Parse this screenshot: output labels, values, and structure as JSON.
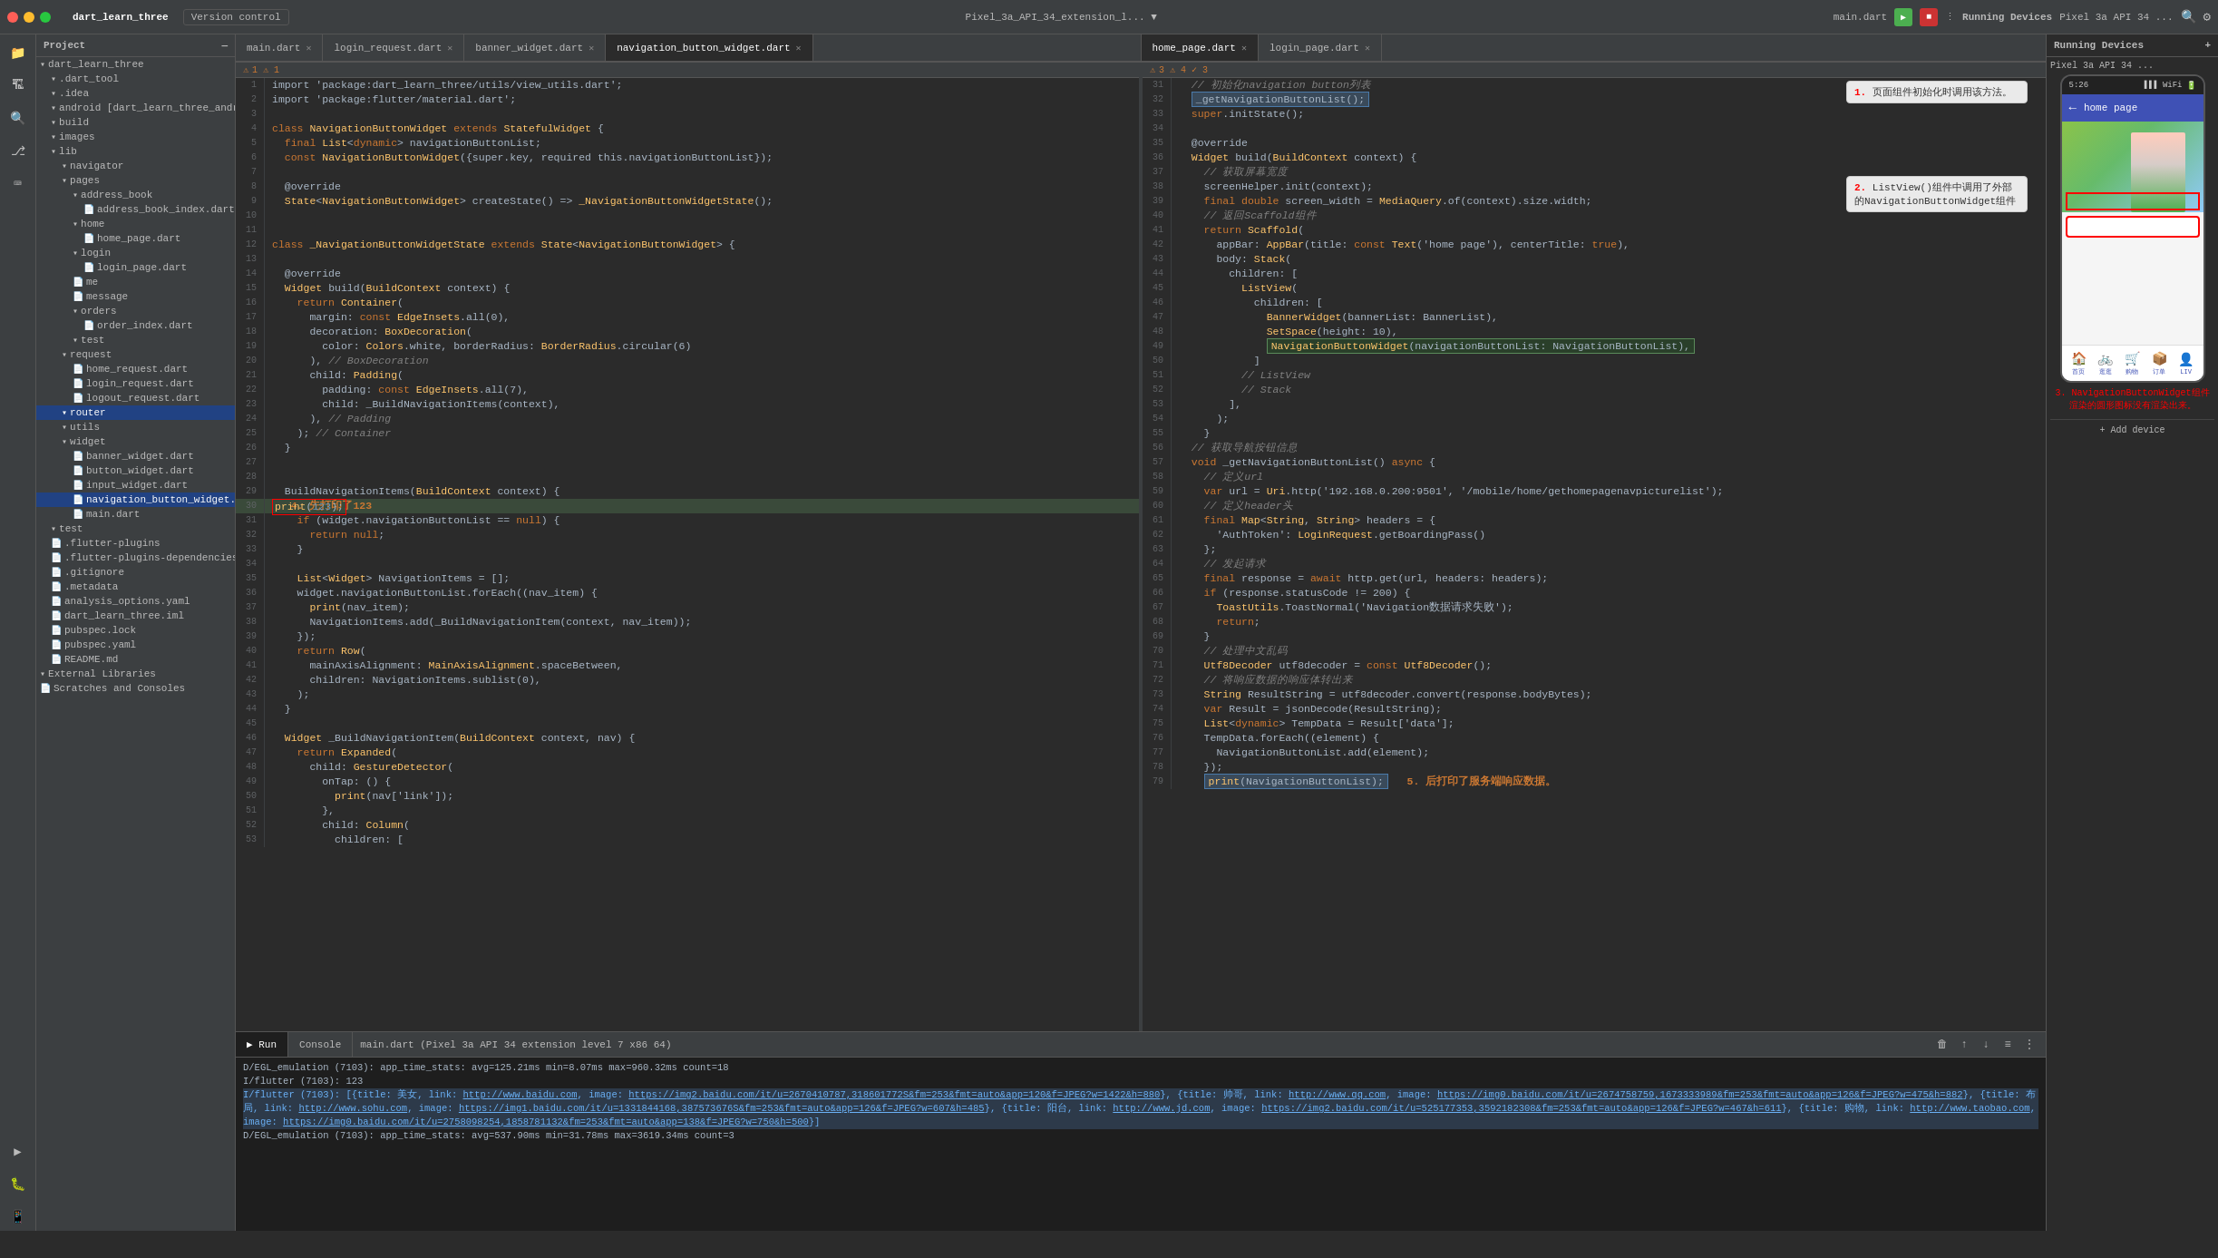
{
  "titleBar": {
    "projectName": "dart_learn_three",
    "versionControl": "Version control",
    "centerTitle": "Pixel_3a_API_34_extension_l... ▼",
    "mainDart": "main.dart",
    "runningDevices": "Running Devices",
    "deviceName": "Pixel 3a API 34 ...",
    "trafficLights": [
      "red",
      "yellow",
      "green"
    ]
  },
  "tabs": {
    "left": [
      {
        "label": "main.dart",
        "active": false
      },
      {
        "label": "login_request.dart",
        "active": false
      },
      {
        "label": "banner_widget.dart",
        "active": false
      },
      {
        "label": "navigation_button_widget.dart",
        "active": true
      }
    ],
    "right": [
      {
        "label": "home_page.dart",
        "active": true
      },
      {
        "label": "login_page.dart",
        "active": false
      }
    ]
  },
  "sidebar": {
    "projectLabel": "Project",
    "items": [
      {
        "indent": 0,
        "icon": "▾",
        "label": "dart_learn_three",
        "path": true
      },
      {
        "indent": 1,
        "icon": "▾",
        "label": ".dart_tool"
      },
      {
        "indent": 1,
        "icon": "▾",
        "label": ".idea"
      },
      {
        "indent": 1,
        "icon": "▾",
        "label": "android [dart_learn_three_android]"
      },
      {
        "indent": 1,
        "icon": "▾",
        "label": "build"
      },
      {
        "indent": 1,
        "icon": "▾",
        "label": "images"
      },
      {
        "indent": 1,
        "icon": "▾",
        "label": "lib"
      },
      {
        "indent": 2,
        "icon": "▾",
        "label": "navigator"
      },
      {
        "indent": 2,
        "icon": "▾",
        "label": "pages"
      },
      {
        "indent": 3,
        "icon": "▾",
        "label": "address_book"
      },
      {
        "indent": 4,
        "icon": "📄",
        "label": "address_book_index.dart"
      },
      {
        "indent": 3,
        "icon": "▾",
        "label": "home"
      },
      {
        "indent": 4,
        "icon": "📄",
        "label": "home_page.dart"
      },
      {
        "indent": 3,
        "icon": "▾",
        "label": "login"
      },
      {
        "indent": 4,
        "icon": "📄",
        "label": "login_page.dart"
      },
      {
        "indent": 3,
        "icon": "📄",
        "label": "me"
      },
      {
        "indent": 3,
        "icon": "📄",
        "label": "message"
      },
      {
        "indent": 3,
        "icon": "▾",
        "label": "orders"
      },
      {
        "indent": 4,
        "icon": "📄",
        "label": "order_index.dart"
      },
      {
        "indent": 3,
        "icon": "▾",
        "label": "test"
      },
      {
        "indent": 2,
        "icon": "▾",
        "label": "request"
      },
      {
        "indent": 3,
        "icon": "📄",
        "label": "home_request.dart"
      },
      {
        "indent": 3,
        "icon": "📄",
        "label": "login_request.dart"
      },
      {
        "indent": 3,
        "icon": "📄",
        "label": "logout_request.dart"
      },
      {
        "indent": 2,
        "icon": "▾",
        "label": "router",
        "selected": true
      },
      {
        "indent": 2,
        "icon": "▾",
        "label": "utils"
      },
      {
        "indent": 2,
        "icon": "▾",
        "label": "widget"
      },
      {
        "indent": 3,
        "icon": "📄",
        "label": "banner_widget.dart"
      },
      {
        "indent": 3,
        "icon": "📄",
        "label": "button_widget.dart"
      },
      {
        "indent": 3,
        "icon": "📄",
        "label": "input_widget.dart"
      },
      {
        "indent": 3,
        "icon": "📄",
        "label": "navigation_button_widget.dart",
        "selected": true
      },
      {
        "indent": 3,
        "icon": "📄",
        "label": "main.dart"
      },
      {
        "indent": 1,
        "icon": "▾",
        "label": "test"
      },
      {
        "indent": 1,
        "icon": "📄",
        "label": ".flutter-plugins"
      },
      {
        "indent": 1,
        "icon": "📄",
        "label": ".flutter-plugins-dependencies"
      },
      {
        "indent": 1,
        "icon": "📄",
        "label": ".gitignore"
      },
      {
        "indent": 1,
        "icon": "📄",
        "label": ".metadata"
      },
      {
        "indent": 1,
        "icon": "📄",
        "label": "analysis_options.yaml"
      },
      {
        "indent": 1,
        "icon": "📄",
        "label": "dart_learn_three.iml"
      },
      {
        "indent": 1,
        "icon": "📄",
        "label": "pubspec.lock"
      },
      {
        "indent": 1,
        "icon": "📄",
        "label": "pubspec.yaml"
      },
      {
        "indent": 1,
        "icon": "📄",
        "label": "README.md"
      },
      {
        "indent": 0,
        "icon": "▾",
        "label": "External Libraries"
      },
      {
        "indent": 0,
        "icon": "📄",
        "label": "Scratches and Consoles"
      }
    ]
  },
  "leftEditor": {
    "filename": "navigation_button_widget.dart",
    "lines": [
      {
        "num": 1,
        "content": "import 'package:dart_learn_three/utils/view_utils.dart';"
      },
      {
        "num": 2,
        "content": "import 'package:flutter/material.dart';"
      },
      {
        "num": 3,
        "content": ""
      },
      {
        "num": 4,
        "content": "class NavigationButtonWidget extends StatefulWidget {"
      },
      {
        "num": 5,
        "content": "  final List<dynamic> navigationButtonList;"
      },
      {
        "num": 6,
        "content": "  const NavigationButtonWidget({super.key, required this.navigationButtonList});"
      },
      {
        "num": 7,
        "content": ""
      },
      {
        "num": 8,
        "content": "  @override"
      },
      {
        "num": 9,
        "content": "  State<NavigationButtonWidget> createState() => _NavigationButtonWidgetState();"
      },
      {
        "num": 10,
        "content": ""
      },
      {
        "num": 11,
        "content": ""
      },
      {
        "num": 12,
        "content": "class _NavigationButtonWidgetState extends State<NavigationButtonWidget> {"
      },
      {
        "num": 13,
        "content": ""
      },
      {
        "num": 14,
        "content": "  @override"
      },
      {
        "num": 15,
        "content": "  Widget build(BuildContext context) {"
      },
      {
        "num": 16,
        "content": "    return Container("
      },
      {
        "num": 17,
        "content": "      margin: const EdgeInsets.all(0),"
      },
      {
        "num": 18,
        "content": "      decoration: BoxDecoration("
      },
      {
        "num": 19,
        "content": "        color: Colors.white, borderRadius: BorderRadius.circular(6)"
      },
      {
        "num": 20,
        "content": "      ), // BoxDecoration"
      },
      {
        "num": 21,
        "content": "      child: Padding("
      },
      {
        "num": 22,
        "content": "        padding: const EdgeInsets.all(7),"
      },
      {
        "num": 23,
        "content": "        child: _BuildNavigationItems(context),"
      },
      {
        "num": 24,
        "content": "      ), // Padding"
      },
      {
        "num": 25,
        "content": "    ); // Container"
      },
      {
        "num": 26,
        "content": "  }"
      },
      {
        "num": 27,
        "content": ""
      },
      {
        "num": 28,
        "content": ""
      },
      {
        "num": 29,
        "content": "  BuildNavigationItems(BuildContext context) {"
      },
      {
        "num": 30,
        "content": "    print(123);   4. 先打印了123"
      },
      {
        "num": 31,
        "content": "    if (widget.navigationButtonList == null) {"
      },
      {
        "num": 32,
        "content": "      return null;"
      },
      {
        "num": 33,
        "content": "    }"
      },
      {
        "num": 34,
        "content": ""
      },
      {
        "num": 35,
        "content": "    List<Widget> NavigationItems = [];"
      },
      {
        "num": 36,
        "content": "    widget.navigationButtonList.forEach((nav_item) {"
      },
      {
        "num": 37,
        "content": "      print(nav_item);"
      },
      {
        "num": 38,
        "content": "      NavigationItems.add(_BuildNavigationItem(context, nav_item));"
      },
      {
        "num": 39,
        "content": "    });"
      },
      {
        "num": 40,
        "content": "    return Row("
      },
      {
        "num": 41,
        "content": "      mainAxisAlignment: MainAxisAlignment.spaceBetween,"
      },
      {
        "num": 42,
        "content": "      children: NavigationItems.sublist(0),"
      },
      {
        "num": 43,
        "content": "    );"
      },
      {
        "num": 44,
        "content": "  }"
      },
      {
        "num": 45,
        "content": ""
      },
      {
        "num": 46,
        "content": "  Widget _BuildNavigationItem(BuildContext context, nav) {"
      },
      {
        "num": 47,
        "content": "    return Expanded("
      },
      {
        "num": 48,
        "content": "      child: GestureDetector("
      },
      {
        "num": 49,
        "content": "        onTap: () {"
      },
      {
        "num": 50,
        "content": "          print(nav['link']);"
      },
      {
        "num": 51,
        "content": "        },"
      },
      {
        "num": 52,
        "content": "        child: Column("
      },
      {
        "num": 53,
        "content": "          children: ["
      }
    ]
  },
  "rightEditor": {
    "filename": "home_page.dart",
    "lines": [
      {
        "num": 31,
        "content": "  // 初始化navigation button列表"
      },
      {
        "num": 32,
        "content": "  _getNavigationButtonList();"
      },
      {
        "num": 33,
        "content": "  super.initState();"
      },
      {
        "num": 34,
        "content": ""
      },
      {
        "num": 35,
        "content": "  @override"
      },
      {
        "num": 36,
        "content": "  Widget build(BuildContext context) {"
      },
      {
        "num": 37,
        "content": "    // 获取屏幕宽度"
      },
      {
        "num": 38,
        "content": "    screenHelper.init(context);"
      },
      {
        "num": 39,
        "content": "    final double screen_width = MediaQuery.of(context).size.width;"
      },
      {
        "num": 40,
        "content": "    // 返回Scaffold组件"
      },
      {
        "num": 41,
        "content": "    return Scaffold("
      },
      {
        "num": 42,
        "content": "      appBar: AppBar(title: const Text('home page'), centerTitle: true),"
      },
      {
        "num": 43,
        "content": "      body: Stack("
      },
      {
        "num": 44,
        "content": "        children: ["
      },
      {
        "num": 45,
        "content": "          ListView("
      },
      {
        "num": 46,
        "content": "            children: ["
      },
      {
        "num": 47,
        "content": "              BannerWidget(bannerList: BannerList),"
      },
      {
        "num": 48,
        "content": "              SetSpace(height: 10),"
      },
      {
        "num": 49,
        "content": "              NavigationButtonWidget(navigationButtonList: NavigationButtonList),"
      },
      {
        "num": 50,
        "content": "            ]"
      },
      {
        "num": 51,
        "content": "          // ListView"
      },
      {
        "num": 52,
        "content": "          // Stack"
      },
      {
        "num": 53,
        "content": "        ],"
      },
      {
        "num": 54,
        "content": "      );"
      },
      {
        "num": 55,
        "content": "    }"
      },
      {
        "num": 56,
        "content": "  // 获取导航按钮信息"
      },
      {
        "num": 57,
        "content": "  void _getNavigationButtonList() async {"
      },
      {
        "num": 58,
        "content": "    // 定义url"
      },
      {
        "num": 59,
        "content": "    var url = Uri.http('192.168.0.200:9501', '/mobile/home/gethomepagenavpicturelist');"
      },
      {
        "num": 60,
        "content": "    // 定义header头"
      },
      {
        "num": 61,
        "content": "    final Map<String, String> headers = {"
      },
      {
        "num": 62,
        "content": "      'AuthToken': LoginRequest.getBoardingPass()"
      },
      {
        "num": 63,
        "content": "    };"
      },
      {
        "num": 64,
        "content": "    // 发起请求"
      },
      {
        "num": 65,
        "content": "    final response = await http.get(url, headers: headers);"
      },
      {
        "num": 66,
        "content": "    if (response.statusCode != 200) {"
      },
      {
        "num": 67,
        "content": "      ToastUtils.ToastNormal('Navigation数据请求失败');"
      },
      {
        "num": 68,
        "content": "      return;"
      },
      {
        "num": 69,
        "content": "    }"
      },
      {
        "num": 70,
        "content": "    // 处理中文乱码"
      },
      {
        "num": 71,
        "content": "    Utf8Decoder utf8decoder = const Utf8Decoder();"
      },
      {
        "num": 72,
        "content": "    // 将响应数据的响应体转出来"
      },
      {
        "num": 73,
        "content": "    String ResultString = utf8decoder.convert(response.bodyBytes);"
      },
      {
        "num": 74,
        "content": "    var Result = jsonDecode(ResultString);"
      },
      {
        "num": 75,
        "content": "    List<dynamic> TempData = Result['data'];"
      },
      {
        "num": 76,
        "content": "    TempData.forEach((element) {"
      },
      {
        "num": 77,
        "content": "      NavigationButtonList.add(element);"
      },
      {
        "num": 78,
        "content": "    });"
      },
      {
        "num": 79,
        "content": "    print(NavigationButtonList);   5. 后打印了服务端响应数据。"
      }
    ]
  },
  "annotations": [
    {
      "num": "1",
      "text": "页面组件初始化时调用该方法。"
    },
    {
      "num": "2",
      "text": "ListView()组件中调用了外部的NavigationButtonWidget组件"
    },
    {
      "num": "3",
      "text": "NavigationButtonWidget组件渲染的圆形图标没有渲染出来。"
    },
    {
      "num": "4",
      "text": "先打印了123"
    },
    {
      "num": "5",
      "text": "后打印了服务端响应数据。"
    }
  ],
  "bottomPanel": {
    "tabs": [
      "Run",
      "Console"
    ],
    "runTab": "main.dart (Pixel 3a API 34 extension level 7 x86_64)",
    "terminalLines": [
      "D/EGL_emulation (7103): app_time_stats: avg=125.21ms min=8.07ms max=960.32ms count=18",
      "I/flutter (7103): 123",
      "I/flutter (7103): [{title: 美女, link: http://www.baidu.com, image: https://img2.baidu.com/it/u=2670410787,318601772S&fm=253&fmt=auto&app=120&f=JPEG?w=1422&h=880}, {title: 帅哥, link: http://www.qq.com, image: https://img0.baidu.com/it/u=2674758759,1673333989&fm=253&fmt=auto&app=126&f=JPEGw=475&h=882}, {title: 布局, link: http://www.sohu.com, image: https://img1.baidu.com/it/u=1331844168,387573676S&fm=253&fmt=auto&app=126&f=JPEG?w=607&h=485}, {title: 阳台, link: http://www.jd.com, image: https://img2.baidu.com/it/u=525177353,3592182308&fm=253&fmt=auto&app=126&f=JPEG?w=467&h=611}, {title: 购物, link: http://www.taobao.com, image: https://img0.baidu.com/it/u=2758098254,1858781132&fm=253&fmt=auto&app=138&f=JPEG?w=750&h=500}]",
      "D/EGL_emulation (7103): app_time_stats: avg=537.90ms min=31.78ms max=3619.34ms count=3"
    ]
  },
  "device": {
    "statusTime": "5:26",
    "pageTitle": "home page",
    "navItems": [
      {
        "icon": "🏠",
        "label": "首页"
      },
      {
        "icon": "🚲",
        "label": "逛逛"
      },
      {
        "icon": "🛒",
        "label": "购物"
      },
      {
        "icon": "📦",
        "label": "订单"
      },
      {
        "icon": "👤",
        "label": "LIV"
      }
    ]
  },
  "runningDevicesLabel": "Running Devices",
  "pixel3aLabel": "Pixel 3a API 34 ..."
}
